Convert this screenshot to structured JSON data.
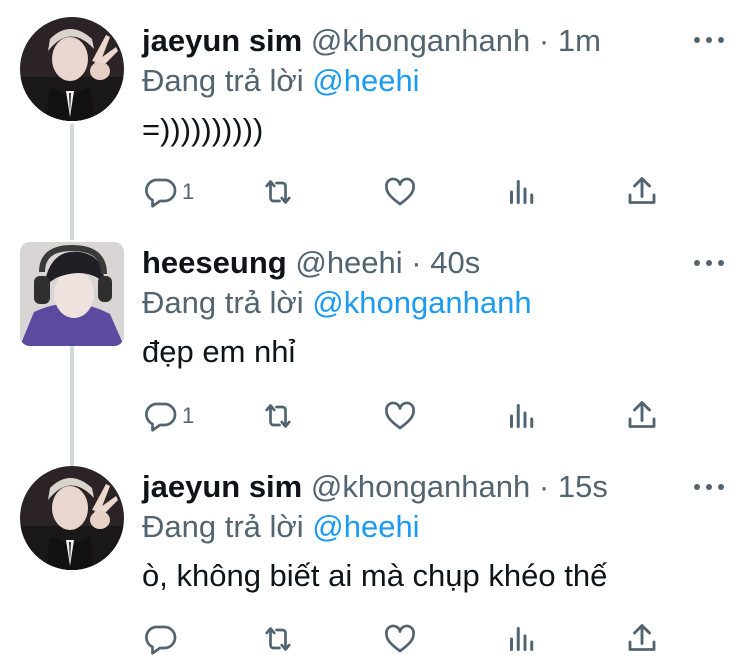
{
  "colors": {
    "text": "#0f1419",
    "secondary": "#536471",
    "link": "#1d9bf0",
    "thread_line": "#cfd9de"
  },
  "reply_prefix": "Đang trả lời",
  "tweets": [
    {
      "display_name": "jaeyun sim",
      "handle": "@khonganhanh",
      "separator": "·",
      "time": "1m",
      "reply_to": "@heehi",
      "text": "=))))))))))",
      "reply_count": "1",
      "avatar": "profile-photo"
    },
    {
      "display_name": "heeseung",
      "handle": "@heehi",
      "separator": "·",
      "time": "40s",
      "reply_to": "@khonganhanh",
      "text": "đẹp em nhỉ",
      "reply_count": "1",
      "avatar": "profile-photo"
    },
    {
      "display_name": "jaeyun sim",
      "handle": "@khonganhanh",
      "separator": "·",
      "time": "15s",
      "reply_to": "@heehi",
      "text": "ò, không biết ai mà chụp khéo thế",
      "reply_count": "",
      "avatar": "profile-photo"
    }
  ],
  "icons": {
    "reply": "reply-icon",
    "retweet": "retweet-icon",
    "like": "heart-icon",
    "views": "views-icon",
    "share": "share-icon",
    "more": "more-icon"
  }
}
